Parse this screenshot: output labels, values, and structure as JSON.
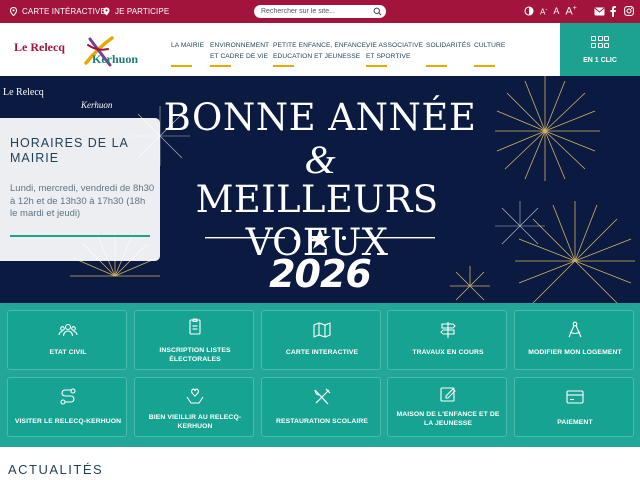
{
  "topbar": {
    "map_link": "CARTE INTÉRACTIVE",
    "participate_link": "JE PARTICIPE",
    "search_placeholder": "Rechercher sur le site...",
    "font_small": "A",
    "font_normal": "A",
    "font_large": "A",
    "font_small_sign": "-",
    "font_large_sign": "+"
  },
  "header": {
    "logo_part1": "Le Relecq",
    "logo_part2": "Kerhuon",
    "nav": [
      {
        "line1": "LA MAIRIE",
        "line2": ""
      },
      {
        "line1": "ENVIRONNEMENT",
        "line2": "ET CADRE DE VIE"
      },
      {
        "line1": "PETITE ENFANCE, ENFANCE,",
        "line2": "EDUCATION ET JEUNESSE"
      },
      {
        "line1": "VIE ASSOCIATIVE",
        "line2": "ET SPORTIVE"
      },
      {
        "line1": "SOLIDARITÉS",
        "line2": ""
      },
      {
        "line1": "CULTURE",
        "line2": ""
      }
    ],
    "one_click": "EN 1 CLIC"
  },
  "hero": {
    "logo_part1": "Le Relecq",
    "logo_part2": "Kerhuon",
    "line1": "BONNE ANNÉE",
    "ampersand": "&",
    "line2": "MEILLEURS VOEUX",
    "year": "2026"
  },
  "hours": {
    "title": "HORAIRES DE LA MAIRIE",
    "text": "Lundi, mercredi, vendredi de 8h30 à 12h et de 13h30 à 17h30 (18h le mardi et jeudi)"
  },
  "tiles": [
    {
      "label": "ETAT CIVIL",
      "icon": "people-icon"
    },
    {
      "label": "INSCRIPTION LISTES ÉLECTORALES",
      "icon": "clipboard-icon"
    },
    {
      "label": "CARTE INTERACTIVE",
      "icon": "map-icon"
    },
    {
      "label": "TRAVAUX EN COURS",
      "icon": "signpost-icon"
    },
    {
      "label": "MODIFIER MON LOGEMENT",
      "icon": "compass-icon"
    },
    {
      "label": "VISITER LE RELECQ-KERHUON",
      "icon": "route-icon"
    },
    {
      "label": "BIEN VIEILLIR AU RELECQ-KERHUON",
      "icon": "care-hands-icon"
    },
    {
      "label": "RESTAURATION SCOLAIRE",
      "icon": "utensils-icon"
    },
    {
      "label": "MAISON DE L'ENFANCE ET DE LA JEUNESSE",
      "icon": "edit-icon"
    },
    {
      "label": "PAIEMENT",
      "icon": "credit-card-icon"
    }
  ],
  "news": {
    "title": "ACTUALITÉS"
  },
  "colors": {
    "brand_red": "#a3143c",
    "teal": "#1ca28f",
    "navy": "#1f3f56",
    "accent": "#e8a800"
  }
}
